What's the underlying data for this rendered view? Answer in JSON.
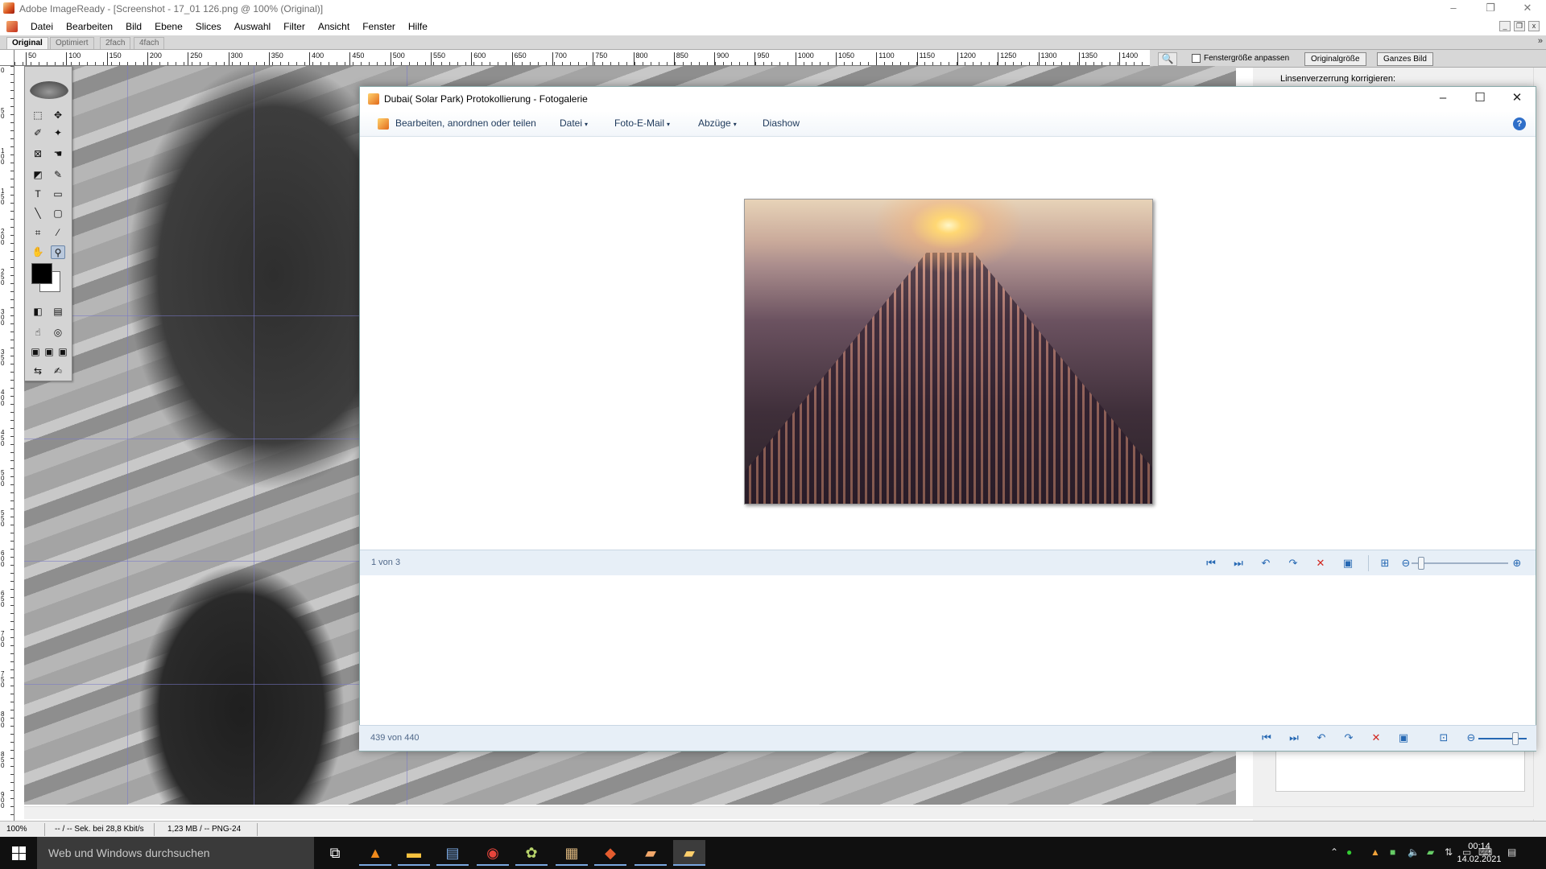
{
  "app": {
    "title": "Adobe ImageReady - [Screenshot - 17_01 126.png @ 100% (Original)]",
    "menu": [
      "Datei",
      "Bearbeiten",
      "Bild",
      "Ebene",
      "Slices",
      "Auswahl",
      "Filter",
      "Ansicht",
      "Fenster",
      "Hilfe"
    ],
    "window_controls": [
      "–",
      "❐",
      "✕"
    ],
    "mdi_controls": [
      "_",
      "❐",
      "x"
    ]
  },
  "doc_tabs": {
    "items": [
      "Original",
      "Optimiert",
      "2fach",
      "4fach"
    ],
    "active": "Original",
    "more": "»"
  },
  "ruler": {
    "h_labels": [
      "50",
      "100",
      "150",
      "200",
      "250",
      "300",
      "350",
      "400",
      "450",
      "500",
      "550",
      "600",
      "650",
      "700",
      "750",
      "800",
      "850",
      "900",
      "950",
      "1000",
      "1050",
      "1100",
      "1150",
      "1200",
      "1250",
      "1300",
      "1350",
      "1400"
    ],
    "v_labels": [
      "0",
      "50",
      "100",
      "150",
      "200",
      "250",
      "300",
      "350",
      "400",
      "450",
      "500",
      "550",
      "600",
      "650",
      "700",
      "750",
      "800",
      "850",
      "900"
    ]
  },
  "ir_toolbar": {
    "magnifier": "🔍",
    "fit_window_label": "Fenstergröße anpassen",
    "fit_window_checked": false,
    "btn_original": "Originalgröße",
    "btn_whole": "Ganzes Bild"
  },
  "ir_panel": {
    "label": "Linsenverzerrung korrigieren:"
  },
  "statusbar": {
    "zoom": "100%",
    "speed": "-- / -- Sek. bei 28,8 Kbit/s",
    "size": "1,23 MB / -- PNG-24"
  },
  "photo_gallery": {
    "title": "Dubai( Solar Park) Protokollierung - Fotogalerie",
    "window_controls": [
      "–",
      "☐",
      "✕"
    ],
    "menu": {
      "edit": "Bearbeiten, anordnen oder teilen",
      "file": "Datei",
      "email": "Foto-E-Mail",
      "prints": "Abzüge",
      "slideshow": "Diashow"
    },
    "help": "?",
    "counter_top": "1 von 3",
    "counter_bottom": "439 von 440",
    "zoom_level": 0.1
  },
  "taskbar": {
    "search_placeholder": "Web und Windows durchsuchen",
    "time": "00:14",
    "date": "14.02.2021",
    "apps": [
      "task-view",
      "vlc",
      "file-explorer",
      "photo-viewer",
      "chrome",
      "picasa",
      "media",
      "ftp",
      "imageready",
      "photo-gallery"
    ]
  },
  "colors": {
    "pg_nav_bg": "#e7eff7",
    "pg_nav_icon": "#2668b3",
    "delete_red": "#d1261e",
    "taskbar": "#101010"
  }
}
